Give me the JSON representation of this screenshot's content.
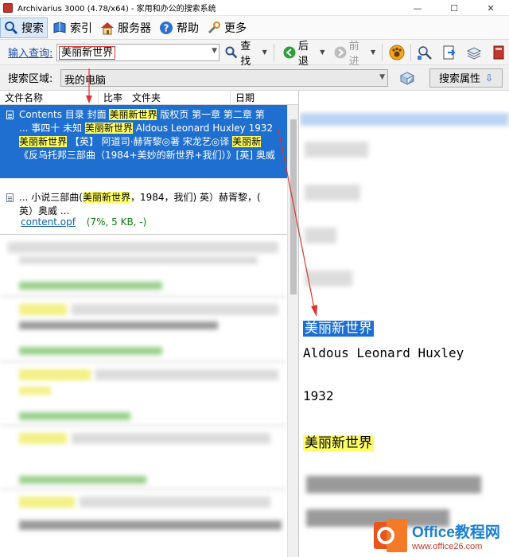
{
  "window": {
    "title": "Archivarius 3000 (4.78/x64) - 家用和办公的搜索系统",
    "controls": [
      "—",
      "☐",
      "✕"
    ]
  },
  "menu": {
    "items": [
      {
        "label": "搜索",
        "icon": "search-icon"
      },
      {
        "label": "索引",
        "icon": "book-icon"
      },
      {
        "label": "服务器",
        "icon": "house-icon"
      },
      {
        "label": "帮助",
        "icon": "help-icon"
      },
      {
        "label": "更多",
        "icon": "tools-icon"
      }
    ]
  },
  "query": {
    "label": "输入查询:",
    "value": "美丽新世界",
    "find_label": "查找",
    "back_label": "后退",
    "forward_label": "前进"
  },
  "area": {
    "label": "搜索区域:",
    "value": "我的电脑",
    "props_label": "搜索属性"
  },
  "results": {
    "columns": [
      "文件名称",
      "比率",
      "文件夹",
      "日期"
    ],
    "first": {
      "line1_a": "Contents 目录 封面",
      "line1_hl": "美丽新世界",
      "line1_b": "版权页 第一章 第二章 第",
      "line2_a": "... 事四十 未知",
      "line2_hl": "美丽新世界",
      "line2_b": "Aldous Leonard Huxley 1932",
      "line3_hl1": "美丽新世界",
      "line3_a": "【英】 阿道司·赫胥黎◎著 宋龙艺◎译",
      "line3_hl2": "美丽新",
      "line4": "《反乌托邦三部曲（1984+美妙的新世界+我们）》[英] 奥威"
    },
    "second": {
      "line1_a": "... 小说三部曲(",
      "line1_hl": "美丽新世界",
      "line1_b": "，1984，我们) 英）赫胥黎，(",
      "line2": "英）奥威 ..."
    },
    "file_name": "content.opf",
    "file_info": "(7%, 5 KB, -)"
  },
  "preview": {
    "title_hl": "美丽新世界",
    "author": "Aldous Leonard Huxley",
    "year": "1932",
    "title2_hl": "美丽新世界"
  },
  "watermark": {
    "main": "Office教程网",
    "sub": "www.office26.com"
  }
}
